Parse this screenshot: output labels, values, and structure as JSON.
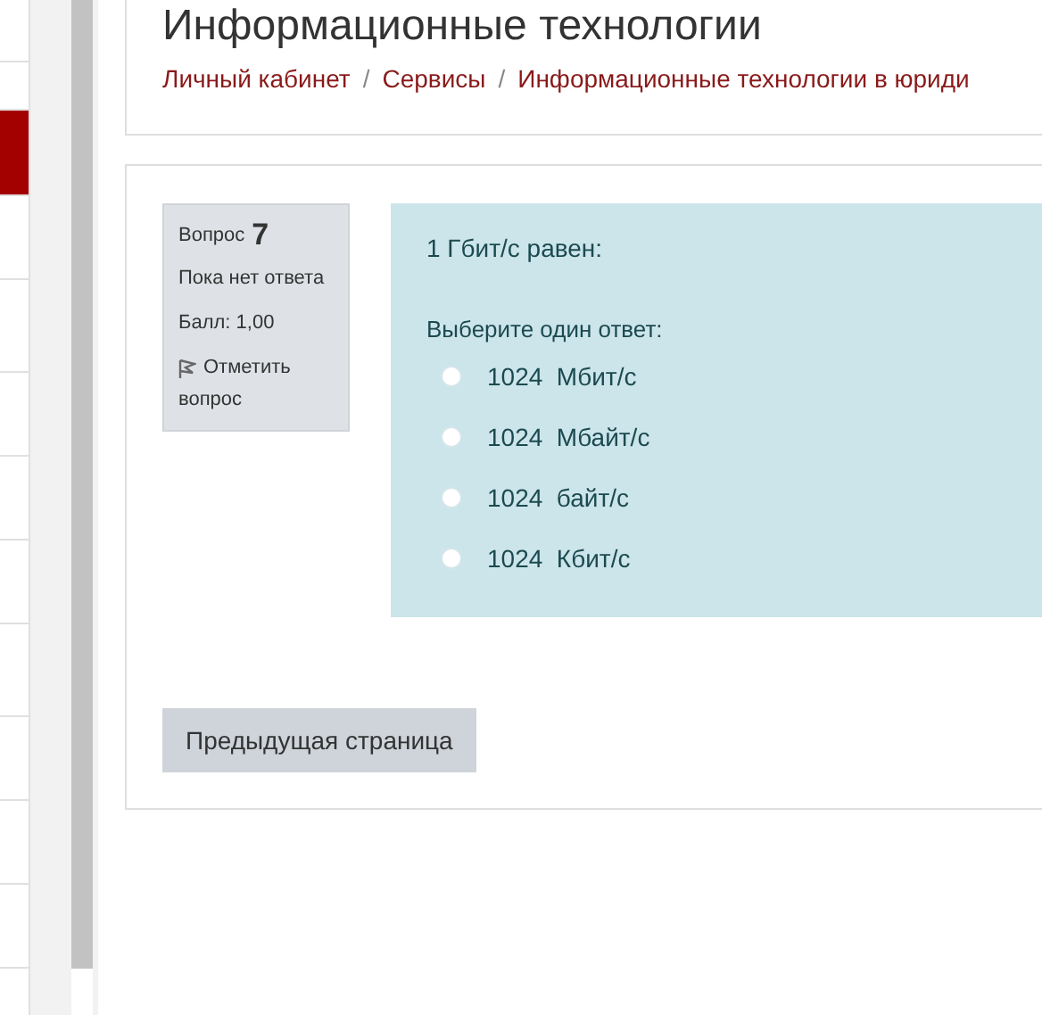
{
  "header": {
    "title": "Информационные технологии",
    "separator": "/",
    "breadcrumbs": [
      {
        "label": "Личный кабинет"
      },
      {
        "label": "Сервисы"
      },
      {
        "label": "Информационные технологии в юриди"
      }
    ]
  },
  "question_info": {
    "label": "Вопрос",
    "number": "7",
    "status": "Пока нет ответа",
    "grade": "Балл: 1,00",
    "flag": "Отметить вопрос"
  },
  "question": {
    "text": "1 Гбит/с равен:",
    "prompt": "Выберите один ответ:",
    "options": [
      {
        "label": "1024  Мбит/с",
        "selected": false
      },
      {
        "label": "1024  Мбайт/с",
        "selected": false
      },
      {
        "label": "1024  байт/с",
        "selected": false
      },
      {
        "label": "1024  Кбит/с",
        "selected": false
      }
    ]
  },
  "buttons": [
    {
      "label": "Предыдущая страница"
    }
  ]
}
